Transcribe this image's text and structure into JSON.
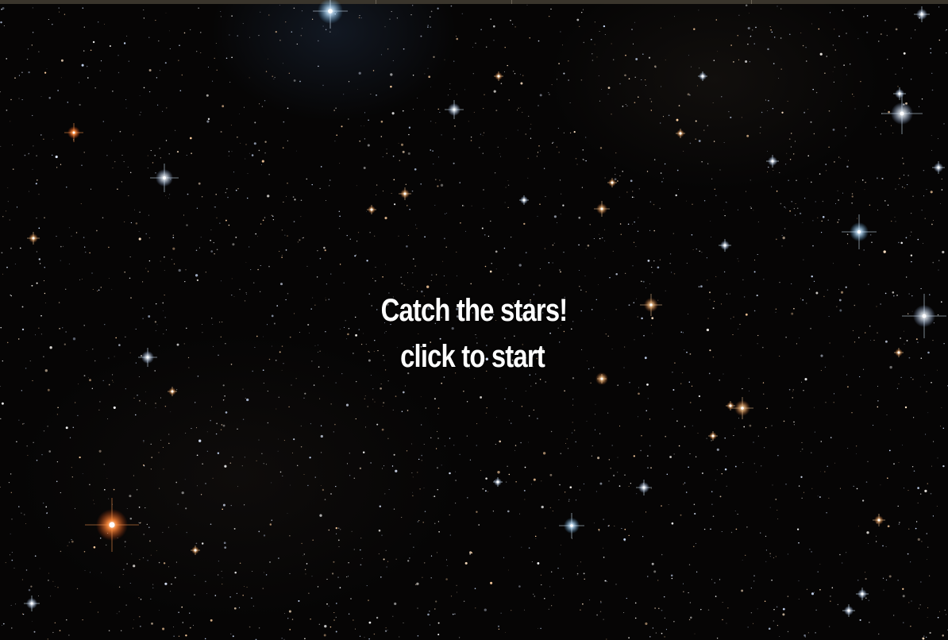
{
  "game": {
    "title": "Catch the stars!",
    "subtitle": "click to start"
  },
  "colors": {
    "background": "#060505",
    "text": "#ffffff",
    "star_blue": "#cfe6ff",
    "star_orange": "#ff7a2a",
    "star_white": "#ffffff"
  }
}
